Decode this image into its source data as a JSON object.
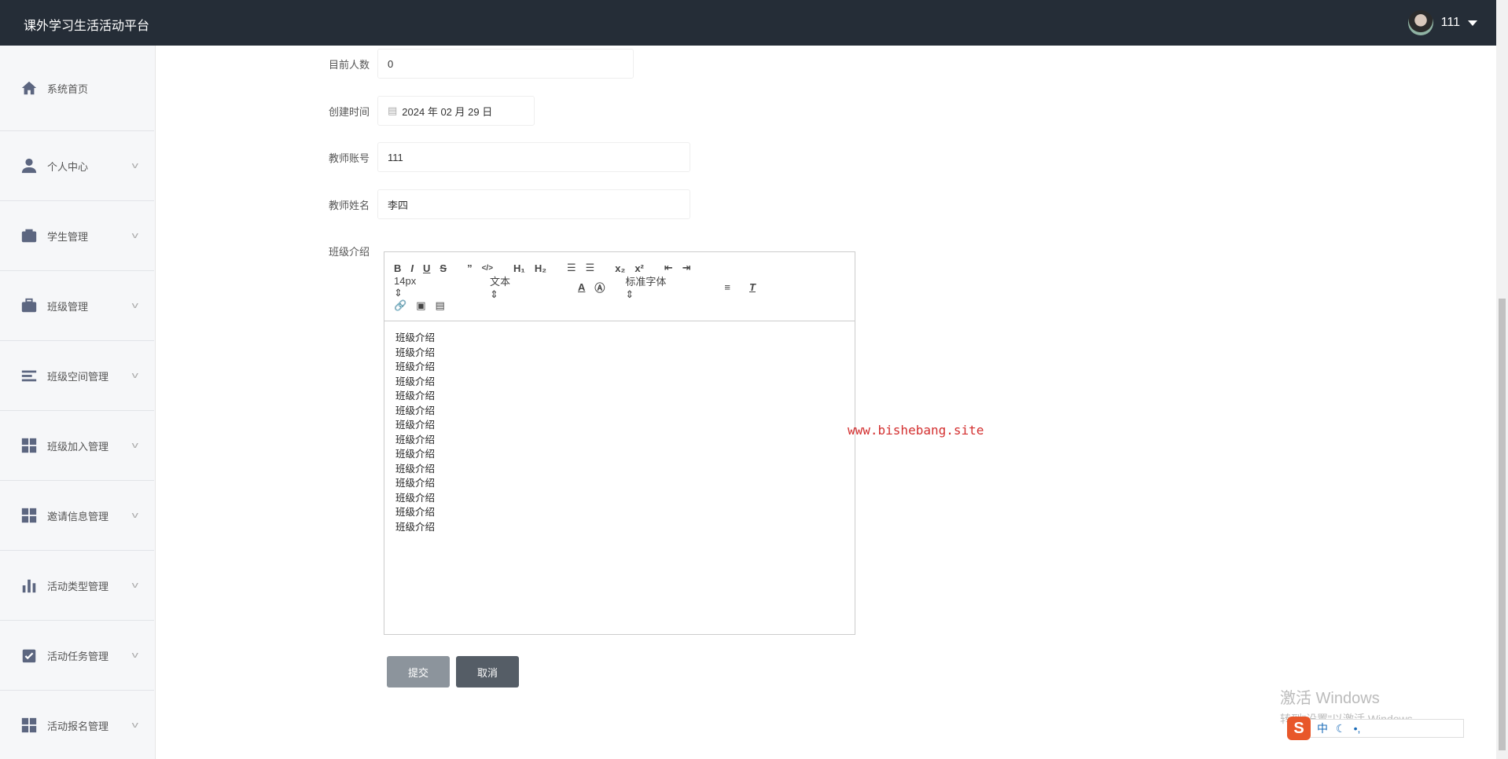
{
  "header": {
    "title": "课外学习生活活动平台",
    "username": "111"
  },
  "sidebar": {
    "items": [
      {
        "label": "系统首页",
        "icon": "home-icon",
        "expandable": false
      },
      {
        "label": "个人中心",
        "icon": "user-icon",
        "expandable": true
      },
      {
        "label": "学生管理",
        "icon": "wallet-icon",
        "expandable": true
      },
      {
        "label": "班级管理",
        "icon": "briefcase-icon",
        "expandable": true
      },
      {
        "label": "班级空间管理",
        "icon": "list-icon",
        "expandable": true
      },
      {
        "label": "班级加入管理",
        "icon": "grid-icon",
        "expandable": true
      },
      {
        "label": "邀请信息管理",
        "icon": "grid-icon",
        "expandable": true
      },
      {
        "label": "活动类型管理",
        "icon": "bar-chart-icon",
        "expandable": true
      },
      {
        "label": "活动任务管理",
        "icon": "clipboard-check-icon",
        "expandable": true
      },
      {
        "label": "活动报名管理",
        "icon": "grid-icon",
        "expandable": true
      }
    ]
  },
  "form": {
    "current_count": {
      "label": "目前人数",
      "value": "0"
    },
    "created_time": {
      "label": "创建时间",
      "value": "2024 年 02 月 29 日"
    },
    "teacher_account": {
      "label": "教师账号",
      "value": "111"
    },
    "teacher_name": {
      "label": "教师姓名",
      "value": "李四"
    },
    "class_intro": {
      "label": "班级介绍",
      "toolbar": {
        "font_size": "14px",
        "header": "文本",
        "font_family": "标准字体"
      },
      "lines": [
        "班级介绍",
        "班级介绍",
        "班级介绍",
        "班级介绍",
        "班级介绍",
        "班级介绍",
        "班级介绍",
        "班级介绍",
        "班级介绍",
        "班级介绍",
        "班级介绍",
        "班级介绍",
        "班级介绍",
        "班级介绍"
      ]
    },
    "submit_label": "提交",
    "cancel_label": "取消"
  },
  "watermark": "www.bishebang.site",
  "windows_activation": {
    "title": "激活 Windows",
    "subtitle": "转到\"设置\"以激活 Windows。"
  },
  "ime": {
    "logo": "S",
    "mode": "中"
  }
}
